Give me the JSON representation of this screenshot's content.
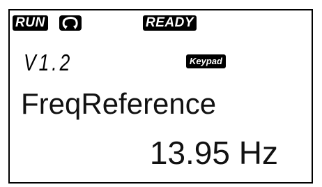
{
  "status": {
    "run_label": "RUN",
    "loop_icon": "loop-arrow-icon",
    "ready_label": "READY"
  },
  "parameter": {
    "code": "V1.2",
    "control_place": "Keypad",
    "name": "FreqReference",
    "value": "13.95",
    "unit": "Hz"
  },
  "colors": {
    "badge_background": "#000000",
    "badge_text": "#ffffff",
    "display_background": "#ffffff",
    "text": "#111111"
  }
}
